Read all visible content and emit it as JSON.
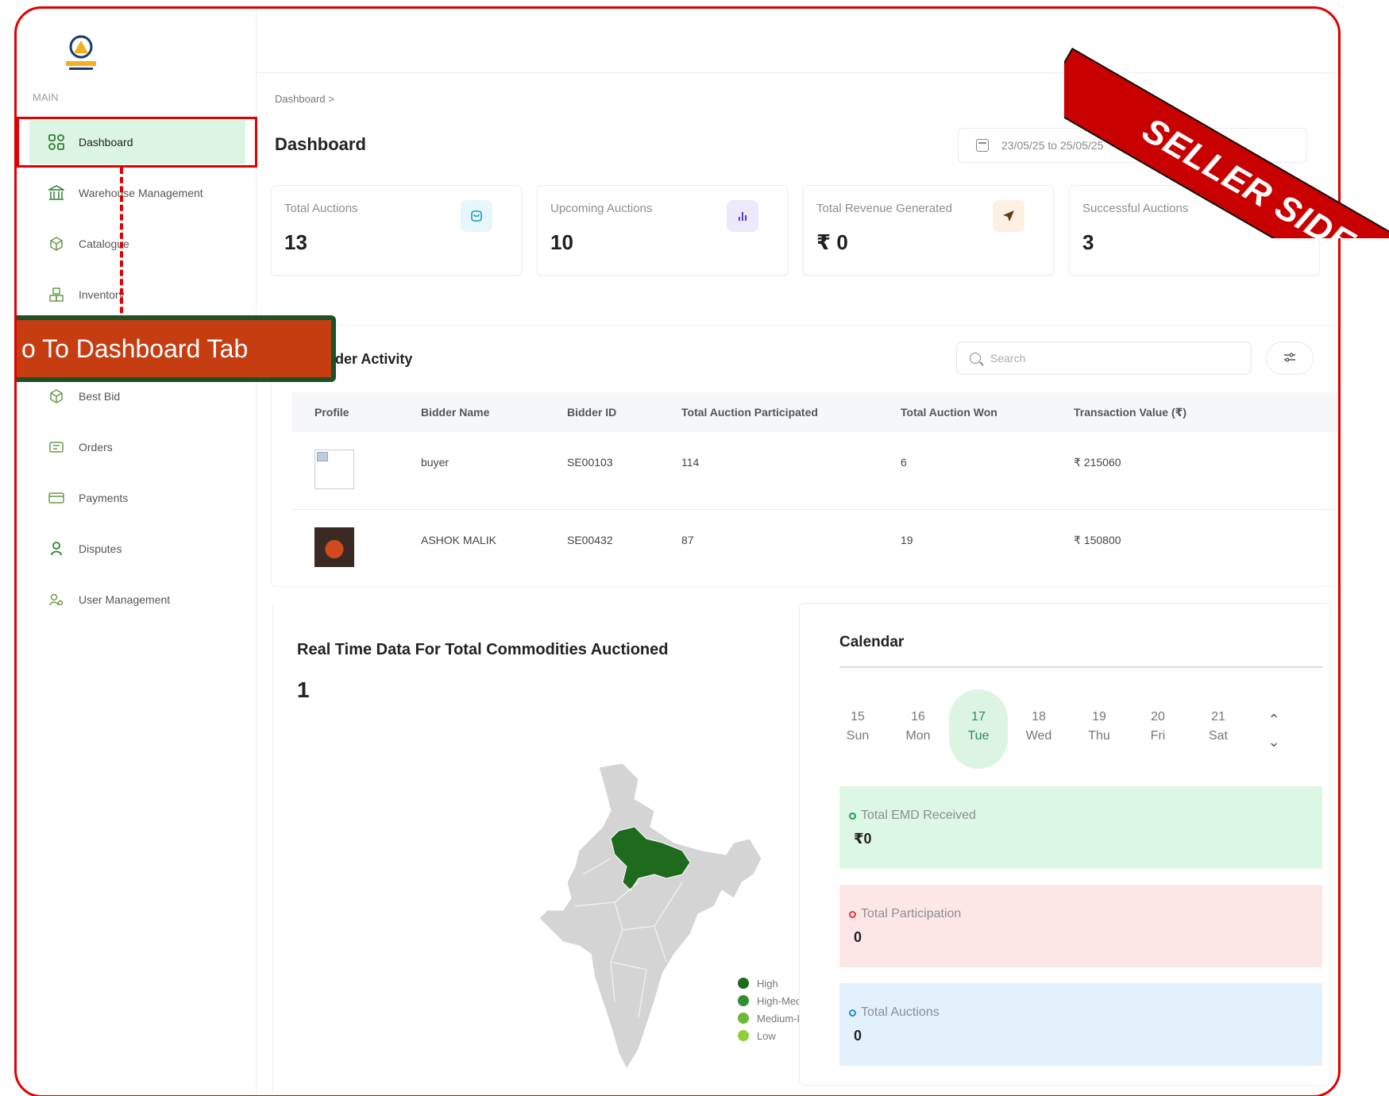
{
  "sidebar": {
    "section_label": "MAIN",
    "items": [
      {
        "label": "Dashboard",
        "icon": "grid-icon"
      },
      {
        "label": "Warehouse Management",
        "icon": "warehouse-icon"
      },
      {
        "label": "Catalogue",
        "icon": "box-icon"
      },
      {
        "label": "Inventory",
        "icon": "boxes-icon"
      },
      {
        "label": "Best Bid",
        "icon": "box-icon"
      },
      {
        "label": "Orders",
        "icon": "orders-icon"
      },
      {
        "label": "Payments",
        "icon": "payments-icon"
      },
      {
        "label": "Disputes",
        "icon": "dispute-icon"
      },
      {
        "label": "User Management",
        "icon": "users-icon"
      }
    ]
  },
  "breadcrumb": "Dashboard  >",
  "page_title": "Dashboard",
  "date_range": "23/05/25 to 25/05/25",
  "stats": [
    {
      "label": "Total Auctions",
      "value": "13",
      "icon": "bag-icon",
      "color": "#e6f7fb"
    },
    {
      "label": "Upcoming Auctions",
      "value": "10",
      "icon": "bar-chart-icon",
      "color": "#ece9fb"
    },
    {
      "label": "Total Revenue Generated",
      "value": "₹ 0",
      "icon": "send-icon",
      "color": "#fdf0e3"
    },
    {
      "label": "Successful Auctions",
      "value": "3",
      "icon": "users-icon",
      "color": "#fdf3dc"
    }
  ],
  "bidder": {
    "title": "der Activity",
    "search_placeholder": "Search",
    "columns": [
      "Profile",
      "Bidder Name",
      "Bidder ID",
      "Total Auction Participated",
      "Total Auction Won",
      "Transaction Value (₹)"
    ],
    "rows": [
      {
        "name": "buyer",
        "id": "SE00103",
        "participated": "114",
        "won": "6",
        "value": "₹ 215060"
      },
      {
        "name": "ASHOK MALIK",
        "id": "SE00432",
        "participated": "87",
        "won": "19",
        "value": "₹ 150800"
      }
    ]
  },
  "callout": "o To Dashboard Tab",
  "commodities": {
    "title": "Real Time Data For Total Commodities Auctioned",
    "value": "1",
    "legend": [
      {
        "label": "High",
        "color": "#1e6b1e"
      },
      {
        "label": "High-Med",
        "color": "#2f8f2f"
      },
      {
        "label": "Medium-L",
        "color": "#6bb83a"
      },
      {
        "label": "Low",
        "color": "#8fcf3e"
      }
    ]
  },
  "calendar": {
    "title": "Calendar",
    "days": [
      {
        "num": "15",
        "name": "Sun"
      },
      {
        "num": "16",
        "name": "Mon"
      },
      {
        "num": "17",
        "name": "Tue"
      },
      {
        "num": "18",
        "name": "Wed"
      },
      {
        "num": "19",
        "name": "Thu"
      },
      {
        "num": "20",
        "name": "Fri"
      },
      {
        "num": "21",
        "name": "Sat"
      }
    ],
    "cards": [
      {
        "label": "Total EMD Received",
        "value": "₹0",
        "bg": "#dcf7e3",
        "ring": "#1f9d55"
      },
      {
        "label": "Total Participation",
        "value": "0",
        "bg": "#fde6e6",
        "ring": "#e53935"
      },
      {
        "label": "Total Auctions",
        "value": "0",
        "bg": "#e3f1fd",
        "ring": "#1e88e5"
      }
    ]
  },
  "ribbon": "SELLER SIDE"
}
